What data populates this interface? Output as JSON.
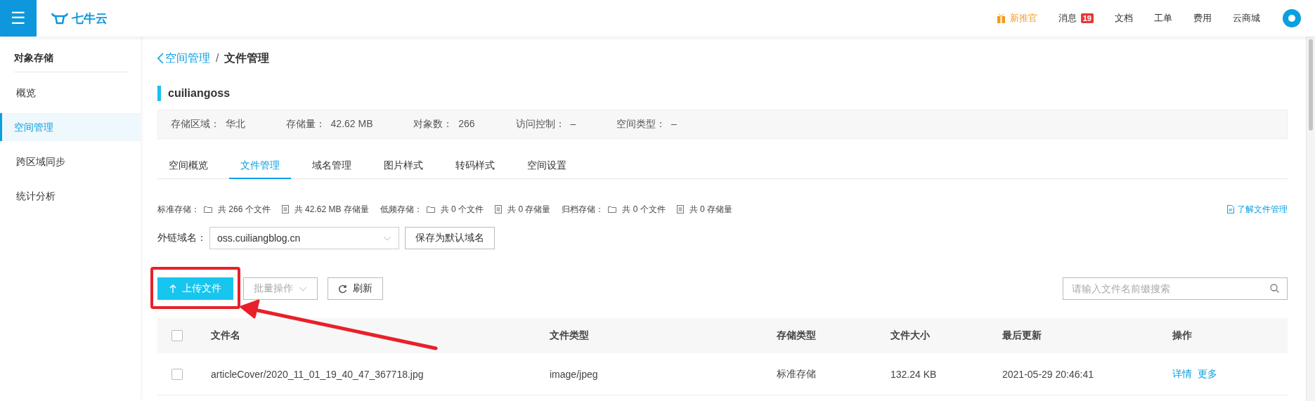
{
  "header": {
    "menu_icon": "☰",
    "logo_text": "七牛云",
    "nav": [
      {
        "label": "新推官",
        "kind": "promo"
      },
      {
        "label": "消息",
        "kind": "badge",
        "badge": "19"
      },
      {
        "label": "文档",
        "kind": "plain"
      },
      {
        "label": "工单",
        "kind": "plain"
      },
      {
        "label": "费用",
        "kind": "plain"
      },
      {
        "label": "云商城",
        "kind": "plain"
      }
    ]
  },
  "sidebar": {
    "title": "对象存储",
    "items": [
      {
        "label": "概览",
        "selected": false
      },
      {
        "label": "空间管理",
        "selected": true
      },
      {
        "label": "跨区域同步",
        "selected": false
      },
      {
        "label": "统计分析",
        "selected": false
      }
    ]
  },
  "breadcrumb": {
    "back": "空间管理",
    "separator": "/",
    "current": "文件管理"
  },
  "bucket": {
    "name": "cuiliangoss",
    "info": [
      {
        "label": "存储区域：",
        "value": "华北"
      },
      {
        "label": "存储量：",
        "value": "42.62 MB"
      },
      {
        "label": "对象数：",
        "value": "266"
      },
      {
        "label": "访问控制：",
        "value": "–"
      },
      {
        "label": "空间类型：",
        "value": "–"
      }
    ]
  },
  "tabs": [
    {
      "label": "空间概览",
      "selected": false
    },
    {
      "label": "文件管理",
      "selected": true
    },
    {
      "label": "域名管理",
      "selected": false
    },
    {
      "label": "图片样式",
      "selected": false
    },
    {
      "label": "转码样式",
      "selected": false
    },
    {
      "label": "空间设置",
      "selected": false
    }
  ],
  "storage_stats": [
    {
      "label": "标准存储：",
      "items": [
        {
          "kind": "folder",
          "text": "共 266 个文件"
        },
        {
          "kind": "doc",
          "text": "共 42.62 MB 存储量"
        }
      ]
    },
    {
      "label": "低频存储：",
      "items": [
        {
          "kind": "folder",
          "text": "共 0 个文件"
        },
        {
          "kind": "doc",
          "text": "共 0 存储量"
        }
      ]
    },
    {
      "label": "归档存储：",
      "items": [
        {
          "kind": "folder",
          "text": "共 0 个文件"
        },
        {
          "kind": "doc",
          "text": "共 0 存储量"
        }
      ]
    }
  ],
  "help_link": "了解文件管理",
  "domain": {
    "label": "外链域名：",
    "value": "oss.cuiliangblog.cn",
    "save_button": "保存为默认域名"
  },
  "toolbar": {
    "upload": "上传文件",
    "batch": {
      "label": "批量操作",
      "disabled": true
    },
    "refresh": "刷新",
    "search_placeholder": "请输入文件名前缀搜索"
  },
  "table": {
    "header_checked": false,
    "columns": [
      "文件名",
      "文件类型",
      "存储类型",
      "文件大小",
      "最后更新",
      "操作"
    ],
    "rows": [
      {
        "checked": false,
        "name": "articleCover/2020_11_01_19_40_47_367718.jpg",
        "type": "image/jpeg",
        "storage": "标准存储",
        "size": "132.24 KB",
        "updated": "2021-05-29 20:46:41",
        "actions": [
          "详情",
          "更多"
        ]
      }
    ]
  }
}
